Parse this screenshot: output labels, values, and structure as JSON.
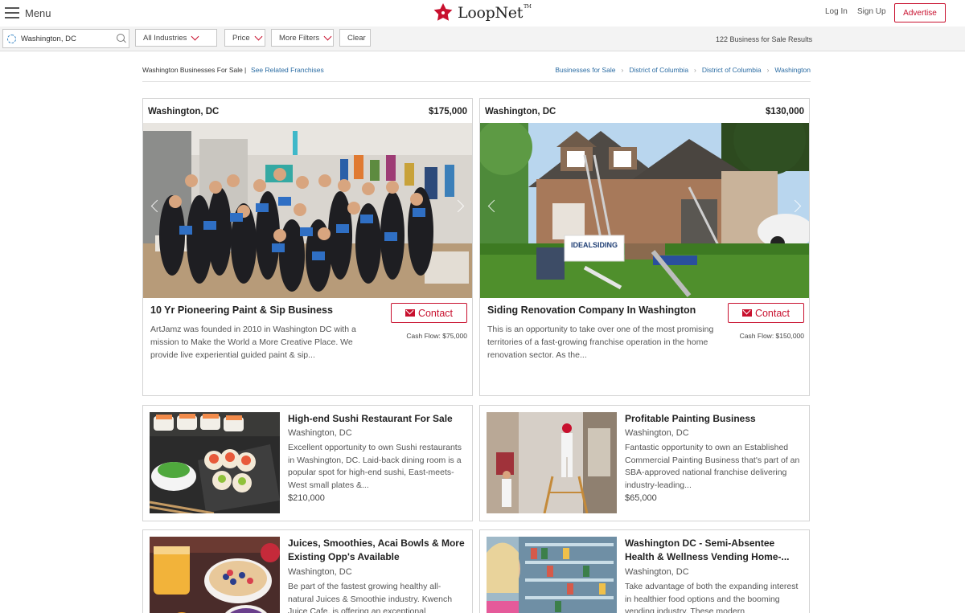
{
  "header": {
    "menu_label": "Menu",
    "logo_text": "LoopNet",
    "logo_tm": "TM",
    "login": "Log In",
    "signup": "Sign Up",
    "advertise": "Advertise"
  },
  "filters": {
    "location_value": "Washington, DC",
    "industries": "All Industries",
    "price": "Price",
    "more_filters": "More Filters",
    "clear": "Clear",
    "results": "122 Business for Sale Results"
  },
  "breadcrumb": {
    "title": "Washington Businesses For Sale",
    "separator": "|",
    "related": "See Related Franchises",
    "items": [
      "Businesses for Sale",
      "District of Columbia",
      "District of Columbia",
      "Washington"
    ]
  },
  "featured": [
    {
      "location": "Washington, DC",
      "price": "$175,000",
      "title": "10 Yr Pioneering Paint & Sip Business",
      "contact": "Contact",
      "cash_flow": "Cash Flow: $75,000",
      "description": "ArtJamz was founded in 2010 in Washington DC with a mission to Make the World a More Creative Place. We provide live experiential guided paint & sip..."
    },
    {
      "location": "Washington, DC",
      "price": "$130,000",
      "title": "Siding Renovation Company In Washington",
      "contact": "Contact",
      "cash_flow": "Cash Flow: $150,000",
      "description": "This is an opportunity to take over one of the most promising territories of a fast-growing franchise operation in the home renovation sector. As the...",
      "sign_text": "IDEALSIDING"
    }
  ],
  "listings": [
    {
      "title": "High-end Sushi Restaurant For Sale",
      "location": "Washington, DC",
      "description": "Excellent opportunity to own Sushi restaurants in Washington, DC. Laid-back dining room is a popular spot for high-end sushi, East-meets-West small plates &...",
      "price": "$210,000"
    },
    {
      "title": "Profitable Painting Business",
      "location": "Washington, DC",
      "description": "Fantastic opportunity to own an Established Commercial Painting Business that's part of an SBA-approved national franchise delivering industry-leading...",
      "price": "$65,000"
    },
    {
      "title": "Juices, Smoothies, Acai Bowls & More Existing Opp's Available",
      "location": "Washington, DC",
      "description": "Be part of the fastest growing healthy all-natural Juices & Smoothie industry. Kwench Juice Cafe, is offering an exceptional"
    },
    {
      "title": "Washington DC - Semi-Absentee Health & Wellness Vending Home-...",
      "location": "Washington, DC",
      "description": "Take advantage of both the expanding interest in healthier food options and the booming vending industry. These modern"
    }
  ],
  "colors": {
    "brand_red": "#c8102e",
    "link_blue": "#2b6ca3",
    "filter_bg": "#f3f3f3"
  },
  "icons": [
    "menu-icon",
    "logo-mark-icon",
    "location-icon",
    "search-icon",
    "chevron-down-icon",
    "envelope-icon",
    "arrow-left-icon",
    "arrow-right-icon",
    "breadcrumb-arrow-icon"
  ]
}
